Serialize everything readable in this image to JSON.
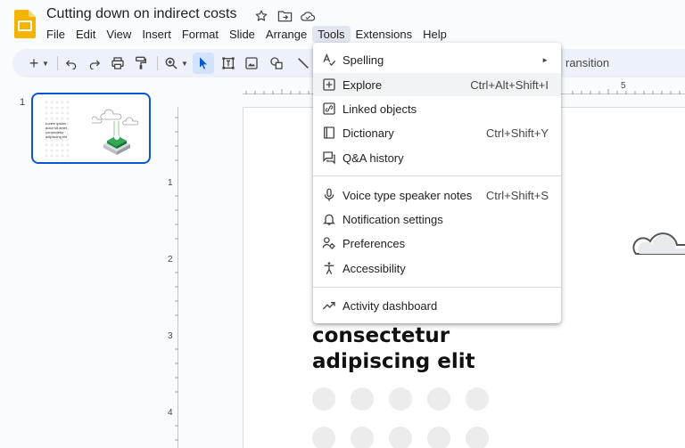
{
  "app": {
    "doc_title": "Cutting down on indirect costs",
    "icons": [
      "star-icon",
      "move-folder-icon",
      "cloud-status-icon"
    ]
  },
  "menubar": [
    "File",
    "Edit",
    "View",
    "Insert",
    "Format",
    "Slide",
    "Arrange",
    "Tools",
    "Extensions",
    "Help"
  ],
  "toolbar": {
    "icons": [
      "new-slide-icon",
      "dropdown-arrow-icon",
      "undo-icon",
      "redo-icon",
      "print-icon",
      "paint-format-icon",
      "zoom-icon",
      "select-icon",
      "select-box-icon",
      "image-icon",
      "shape-icon",
      "line-icon"
    ],
    "transition_text": "ransition"
  },
  "filmstrip": {
    "slide_number": "1",
    "thumb_text": "Lorem ipsum dolor sit amet consectetur adipiscing elit"
  },
  "rulers": {
    "top_label": "5",
    "left_labels": [
      "1",
      "2",
      "3",
      "4"
    ]
  },
  "slide": {
    "line1": "consectetur",
    "line2": "adipiscing elit"
  },
  "tools_menu": {
    "items": [
      {
        "label": "Spelling",
        "shortcut": "",
        "icon": "spelling-icon",
        "submenu": true
      },
      {
        "label": "Explore",
        "shortcut": "Ctrl+Alt+Shift+I",
        "icon": "explore-icon",
        "highlighted": true
      },
      {
        "label": "Linked objects",
        "shortcut": "",
        "icon": "linked-objects-icon"
      },
      {
        "label": "Dictionary",
        "shortcut": "Ctrl+Shift+Y",
        "icon": "dictionary-icon"
      },
      {
        "label": "Q&A history",
        "shortcut": "",
        "icon": "qa-history-icon"
      },
      {
        "label": "Voice type speaker notes",
        "shortcut": "Ctrl+Shift+S",
        "icon": "microphone-icon"
      },
      {
        "label": "Notification settings",
        "shortcut": "",
        "icon": "bell-icon"
      },
      {
        "label": "Preferences",
        "shortcut": "",
        "icon": "preferences-icon"
      },
      {
        "label": "Accessibility",
        "shortcut": "",
        "icon": "accessibility-icon"
      },
      {
        "label": "Activity dashboard",
        "shortcut": "",
        "icon": "trending-icon"
      }
    ],
    "submenu_arrow": "►"
  },
  "colors": {
    "accent": "#0b57d0",
    "logo": "#f4b400",
    "toolbar_bg": "#edf2fa"
  }
}
